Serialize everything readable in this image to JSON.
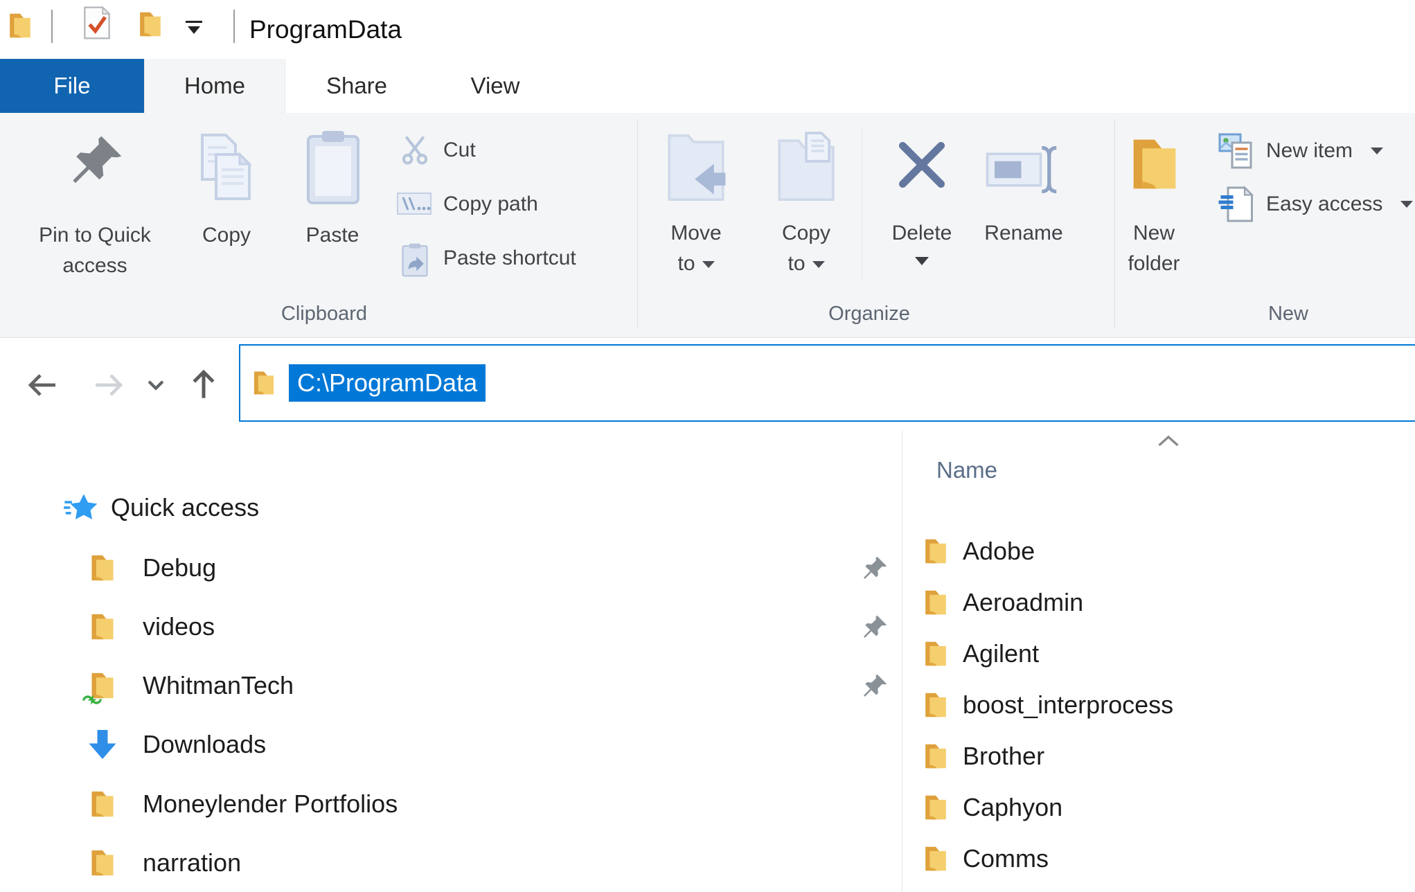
{
  "window": {
    "title": "ProgramData"
  },
  "tabs": {
    "file": "File",
    "home": "Home",
    "share": "Share",
    "view": "View"
  },
  "ribbon": {
    "pin_line1": "Pin to Quick",
    "pin_line2": "access",
    "copy": "Copy",
    "paste": "Paste",
    "cut": "Cut",
    "copy_path": "Copy path",
    "paste_shortcut": "Paste shortcut",
    "move_line1": "Move",
    "move_line2": "to",
    "copy_to_line1": "Copy",
    "copy_to_line2": "to",
    "delete": "Delete",
    "rename": "Rename",
    "new_folder_line1": "New",
    "new_folder_line2": "folder",
    "new_item": "New item",
    "easy_access": "Easy access",
    "groups": {
      "clipboard": "Clipboard",
      "organize": "Organize",
      "new": "New"
    }
  },
  "address_bar": {
    "path": "C:\\ProgramData"
  },
  "sidebar": {
    "section": "Quick access",
    "items": [
      {
        "label": "Debug",
        "pinned": true
      },
      {
        "label": "videos",
        "pinned": true
      },
      {
        "label": "WhitmanTech",
        "pinned": true
      },
      {
        "label": "Downloads",
        "pinned": false
      },
      {
        "label": "Moneylender Portfolios",
        "pinned": false
      },
      {
        "label": "narration",
        "pinned": false
      }
    ]
  },
  "file_list": {
    "column_header": "Name",
    "items": [
      "Adobe",
      "Aeroadmin",
      "Agilent",
      "boost_interprocess",
      "Brother",
      "Caphyon",
      "Comms"
    ]
  },
  "colors": {
    "accent_blue": "#0078d7",
    "file_tab_blue": "#1164b0",
    "folder_yellow": "#f5cf6e"
  }
}
